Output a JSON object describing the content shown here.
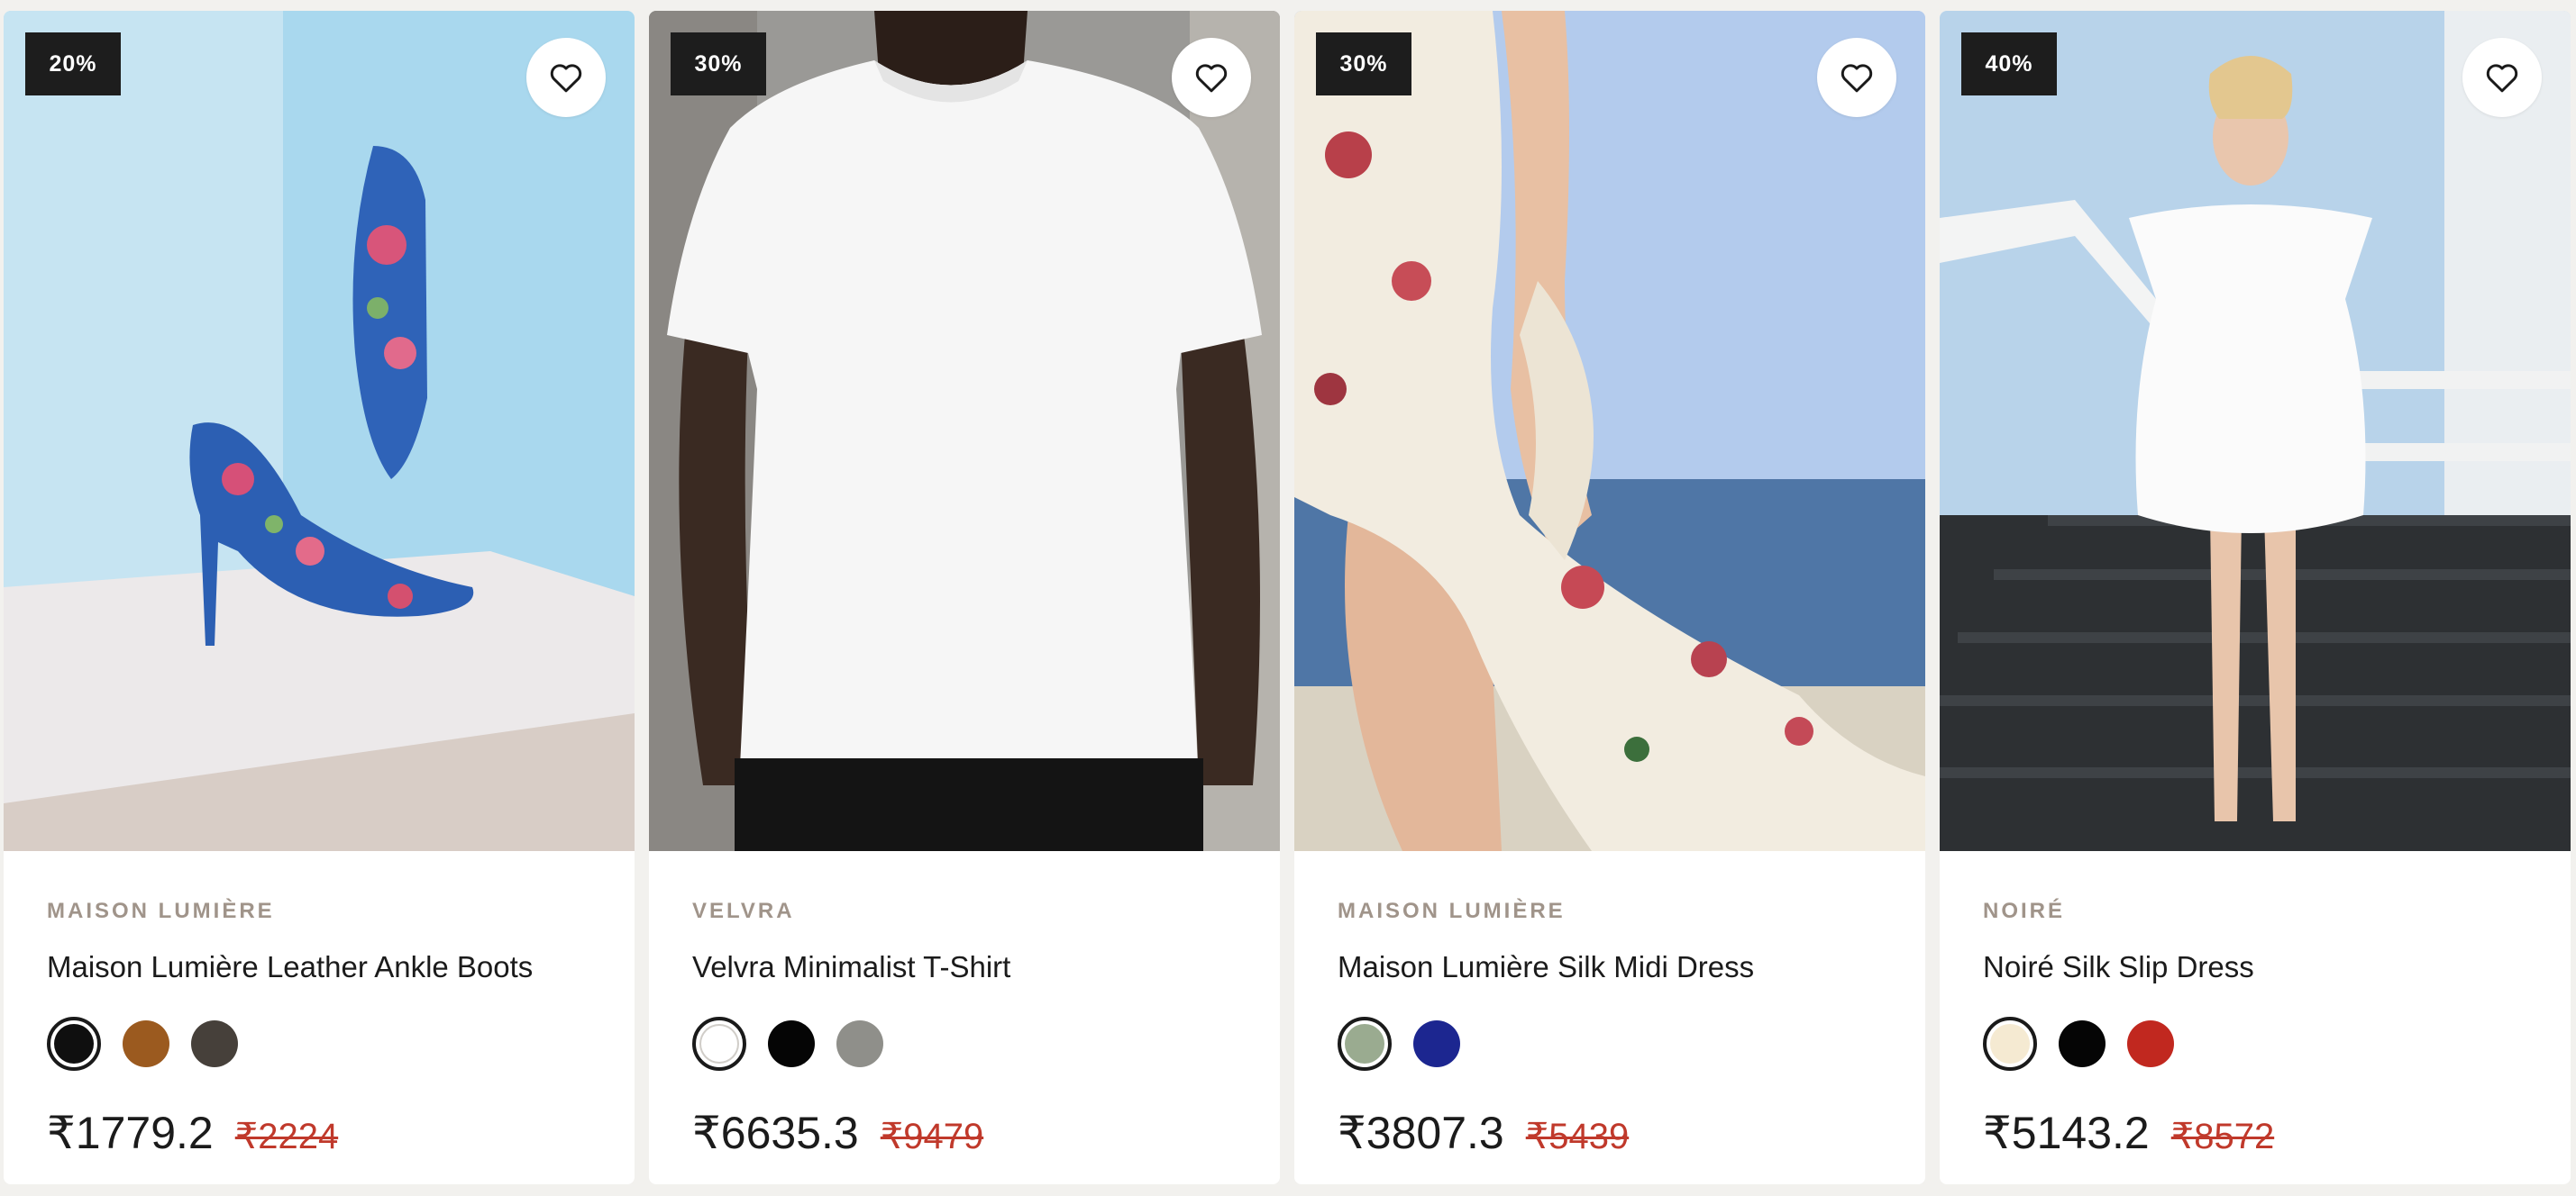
{
  "products": [
    {
      "discount": "20%",
      "brand": "MAISON LUMIÈRE",
      "name": "Maison Lumière Leather Ankle Boots",
      "price": "₹1779.2",
      "mrp": "₹2224",
      "swatches": [
        {
          "color": "#0f0f0f",
          "selected": true
        },
        {
          "color": "#9b5a1f",
          "selected": false
        },
        {
          "color": "#46403a",
          "selected": false
        }
      ]
    },
    {
      "discount": "30%",
      "brand": "VELVRA",
      "name": "Velvra Minimalist T-Shirt",
      "price": "₹6635.3",
      "mrp": "₹9479",
      "swatches": [
        {
          "color": "#ffffff",
          "selected": true
        },
        {
          "color": "#050505",
          "selected": false
        },
        {
          "color": "#8f8f8a",
          "selected": false
        }
      ]
    },
    {
      "discount": "30%",
      "brand": "MAISON LUMIÈRE",
      "name": "Maison Lumière Silk Midi Dress",
      "price": "₹3807.3",
      "mrp": "₹5439",
      "swatches": [
        {
          "color": "#9aab90",
          "selected": true
        },
        {
          "color": "#1c2690",
          "selected": false
        }
      ]
    },
    {
      "discount": "40%",
      "brand": "NOIRÉ",
      "name": "Noiré Silk Slip Dress",
      "price": "₹5143.2",
      "mrp": "₹8572",
      "swatches": [
        {
          "color": "#f5ead2",
          "selected": true
        },
        {
          "color": "#050505",
          "selected": false
        },
        {
          "color": "#c1281f",
          "selected": false
        }
      ]
    }
  ],
  "icons": {
    "wishlist": "heart-outline-icon"
  }
}
